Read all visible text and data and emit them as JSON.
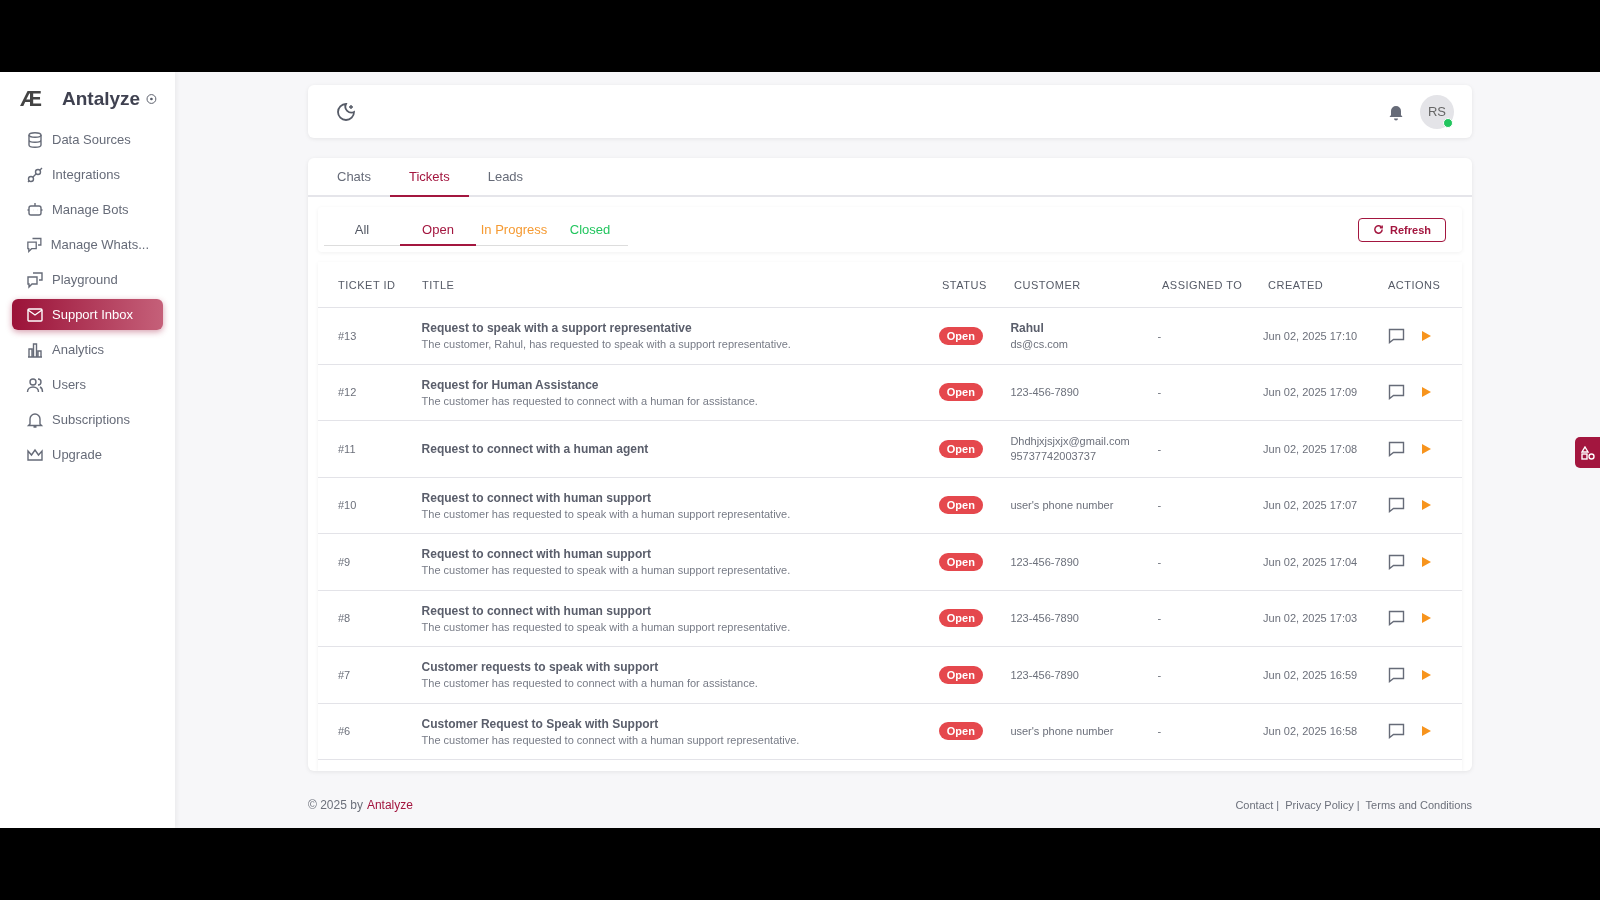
{
  "brand": {
    "logo": "Æ",
    "name": "Antalyze"
  },
  "sidebar": {
    "items": [
      {
        "label": "Data Sources",
        "selected": false
      },
      {
        "label": "Integrations",
        "selected": false
      },
      {
        "label": "Manage Bots",
        "selected": false
      },
      {
        "label": "Manage Whats...",
        "selected": false
      },
      {
        "label": "Playground",
        "selected": false
      },
      {
        "label": "Support Inbox",
        "selected": true
      },
      {
        "label": "Analytics",
        "selected": false
      },
      {
        "label": "Users",
        "selected": false
      },
      {
        "label": "Subscriptions",
        "selected": false
      },
      {
        "label": "Upgrade",
        "selected": false
      }
    ]
  },
  "header": {
    "avatar": "RS",
    "online": true
  },
  "tabs": [
    {
      "label": "Chats",
      "selected": false
    },
    {
      "label": "Tickets",
      "selected": true
    },
    {
      "label": "Leads",
      "selected": false
    }
  ],
  "filters": [
    {
      "label": "All",
      "selected": false,
      "color": "#555a66"
    },
    {
      "label": "Open",
      "selected": true,
      "color": "#a3163f"
    },
    {
      "label": "In Progress",
      "selected": false,
      "color": "#f59a32"
    },
    {
      "label": "Closed",
      "selected": false,
      "color": "#22c55e"
    }
  ],
  "refresh_button": "Refresh",
  "table": {
    "columns": [
      "TICKET ID",
      "TITLE",
      "STATUS",
      "CUSTOMER",
      "ASSIGNED TO",
      "CREATED",
      "ACTIONS"
    ],
    "rows": [
      {
        "id": "#13",
        "title": "Request to speak with a support representative",
        "description": "The customer, Rahul, has requested to speak with a support representative.",
        "status": "Open",
        "customer_name": "Rahul",
        "customer_lines": [
          "ds@cs.com"
        ],
        "assigned": "-",
        "created": "Jun 02, 2025 17:10"
      },
      {
        "id": "#12",
        "title": "Request for Human Assistance",
        "description": "The customer has requested to connect with a human for assistance.",
        "status": "Open",
        "customer_lines": [
          "123-456-7890"
        ],
        "assigned": "-",
        "created": "Jun 02, 2025 17:09"
      },
      {
        "id": "#11",
        "title": "Request to connect with a human agent",
        "status": "Open",
        "customer_lines": [
          "Dhdhjxjsjxjx@gmail.com",
          "95737742003737"
        ],
        "assigned": "-",
        "created": "Jun 02, 2025 17:08"
      },
      {
        "id": "#10",
        "title": "Request to connect with human support",
        "description": "The customer has requested to speak with a human support representative.",
        "status": "Open",
        "customer_lines": [
          "user's phone number"
        ],
        "assigned": "-",
        "created": "Jun 02, 2025 17:07"
      },
      {
        "id": "#9",
        "title": "Request to connect with human support",
        "description": "The customer has requested to speak with a human support representative.",
        "status": "Open",
        "customer_lines": [
          "123-456-7890"
        ],
        "assigned": "-",
        "created": "Jun 02, 2025 17:04"
      },
      {
        "id": "#8",
        "title": "Request to connect with human support",
        "description": "The customer has requested to speak with a human support representative.",
        "status": "Open",
        "customer_lines": [
          "123-456-7890"
        ],
        "assigned": "-",
        "created": "Jun 02, 2025 17:03"
      },
      {
        "id": "#7",
        "title": "Customer requests to speak with support",
        "description": "The customer has requested to connect with a human for assistance.",
        "status": "Open",
        "customer_lines": [
          "123-456-7890"
        ],
        "assigned": "-",
        "created": "Jun 02, 2025 16:59"
      },
      {
        "id": "#6",
        "title": "Customer Request to Speak with Support",
        "description": "The customer has requested to connect with a human support representative.",
        "status": "Open",
        "customer_lines": [
          "user's phone number"
        ],
        "assigned": "-",
        "created": "Jun 02, 2025 16:58"
      }
    ]
  },
  "footer": {
    "copyright": "© 2025  by",
    "brand_link": "Antalyze",
    "links": [
      "Contact |",
      "Privacy Policy |",
      "Terms and Conditions"
    ]
  }
}
